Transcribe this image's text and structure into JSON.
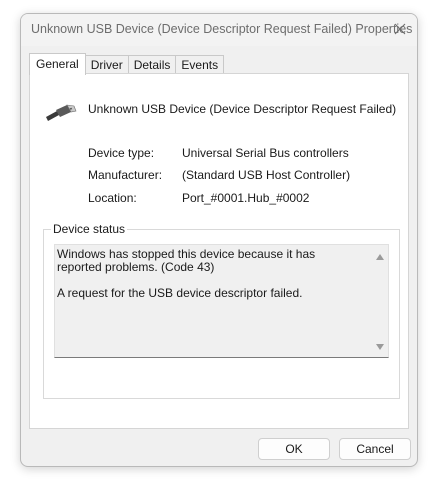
{
  "window": {
    "title": "Unknown USB Device (Device Descriptor Request Failed) Properties"
  },
  "tabs": [
    {
      "label": "General",
      "active": true
    },
    {
      "label": "Driver",
      "active": false
    },
    {
      "label": "Details",
      "active": false
    },
    {
      "label": "Events",
      "active": false
    }
  ],
  "device": {
    "icon": "usb-plug-icon",
    "name": "Unknown USB Device (Device Descriptor Request Failed)"
  },
  "properties": [
    {
      "label": "Device type:",
      "value": "Universal Serial Bus controllers"
    },
    {
      "label": "Manufacturer:",
      "value": "(Standard USB Host Controller)"
    },
    {
      "label": "Location:",
      "value": "Port_#0001.Hub_#0002"
    }
  ],
  "status": {
    "legend": "Device status",
    "text": "Windows has stopped this device because it has reported problems. (Code 43)\n\nA request for the USB device descriptor failed."
  },
  "buttons": {
    "ok": "OK",
    "cancel": "Cancel"
  },
  "colors": {
    "window_bg": "#f0f0f0",
    "panel_bg": "#ffffff",
    "title_text": "#6d6d6d"
  }
}
